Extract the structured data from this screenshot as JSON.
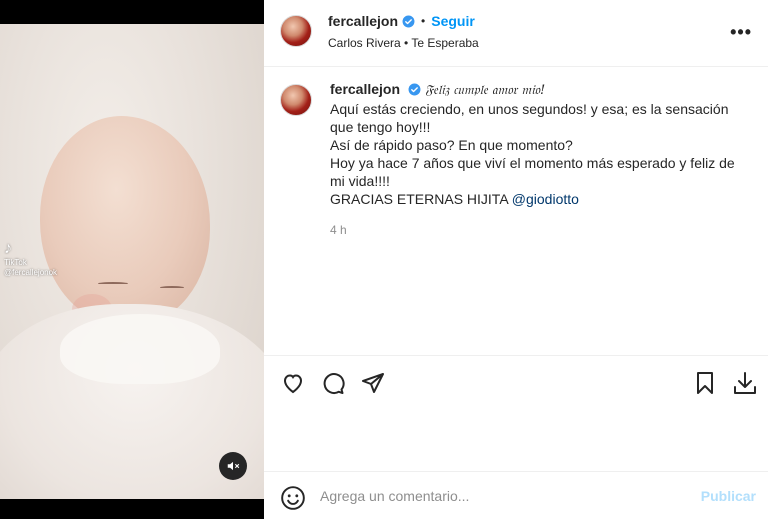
{
  "media": {
    "tiktok_label": "TikTok",
    "tiktok_handle": "@fercallejonok"
  },
  "header": {
    "username": "fercallejon",
    "separator": "•",
    "follow_label": "Seguir",
    "audio": "Carlos Rivera • Te Esperaba",
    "more_label": "•••"
  },
  "caption": {
    "username": "fercallejon",
    "headline": "𝔉𝔢𝔩𝔦𝔷 𝔠𝔲𝔪𝔭𝔩𝔢 𝔞𝔪𝔬𝔯 𝔪𝔦𝔬!",
    "lines": [
      "Aquí estás creciendo, en unos segundos! y esa; es la sensación",
      "que tengo hoy!!!",
      "Así de rápido paso? En que momento?",
      "Hoy ya hace 7 años que viví el momento más esperado y feliz de",
      "mi vida!!!!"
    ],
    "last_line_text": "GRACIAS ETERNAS HIJITA",
    "mention": "@giodiotto",
    "time": "4 h"
  },
  "comment": {
    "placeholder": "Agrega un comentario...",
    "post_label": "Publicar"
  },
  "colors": {
    "accent": "#0095f6",
    "post_disabled": "#b2dffc",
    "verified": "#3897f0",
    "mention": "#00376b"
  },
  "icons": [
    "heart-icon",
    "comment-icon",
    "share-icon",
    "save-icon",
    "download-icon",
    "emoji-icon",
    "mute-icon",
    "tiktok-icon",
    "verified-icon",
    "more-icon"
  ]
}
